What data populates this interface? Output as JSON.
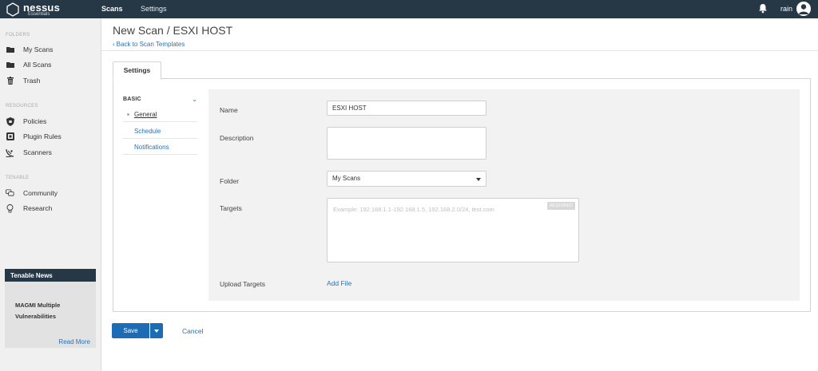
{
  "app": {
    "logo_name": "nessus",
    "logo_sub": "Essentials",
    "accent_color": "#1c6cb5",
    "topbar_color": "#263746"
  },
  "topnav": {
    "scans": "Scans",
    "settings": "Settings",
    "user": "rain",
    "notifications_icon": "bell-icon",
    "avatar_icon": "user-avatar-icon"
  },
  "sidebar": {
    "folders_heading": "FOLDERS",
    "folders": [
      {
        "label": "My Scans",
        "icon": "folder-icon"
      },
      {
        "label": "All Scans",
        "icon": "folder-icon"
      },
      {
        "label": "Trash",
        "icon": "trash-icon"
      }
    ],
    "resources_heading": "RESOURCES",
    "resources": [
      {
        "label": "Policies",
        "icon": "shield-icon"
      },
      {
        "label": "Plugin Rules",
        "icon": "plugin-rules-icon"
      },
      {
        "label": "Scanners",
        "icon": "satellite-dish-icon"
      }
    ],
    "tenable_heading": "TENABLE",
    "tenable": [
      {
        "label": "Community",
        "icon": "community-icon"
      },
      {
        "label": "Research",
        "icon": "lightbulb-icon"
      }
    ],
    "news": {
      "heading": "Tenable News",
      "headline": "MAGMI Multiple Vulnerabilities",
      "read_more": "Read More"
    }
  },
  "page": {
    "title": "New Scan / ESXI HOST",
    "back_link": "Back to Scan Templates",
    "tab": "Settings"
  },
  "settings_nav": {
    "category": "BASIC",
    "items": [
      "General",
      "Schedule",
      "Notifications"
    ],
    "active": "General"
  },
  "form": {
    "name_label": "Name",
    "name_value": "ESXI HOST",
    "description_label": "Description",
    "description_value": "",
    "folder_label": "Folder",
    "folder_value": "My Scans",
    "targets_label": "Targets",
    "targets_placeholder": "Example: 192.168.1.1-192.168.1.5, 192.168.2.0/24, test.com",
    "targets_required": "REQUIRED",
    "upload_label": "Upload Targets",
    "add_file": "Add File"
  },
  "actions": {
    "save": "Save",
    "cancel": "Cancel"
  }
}
